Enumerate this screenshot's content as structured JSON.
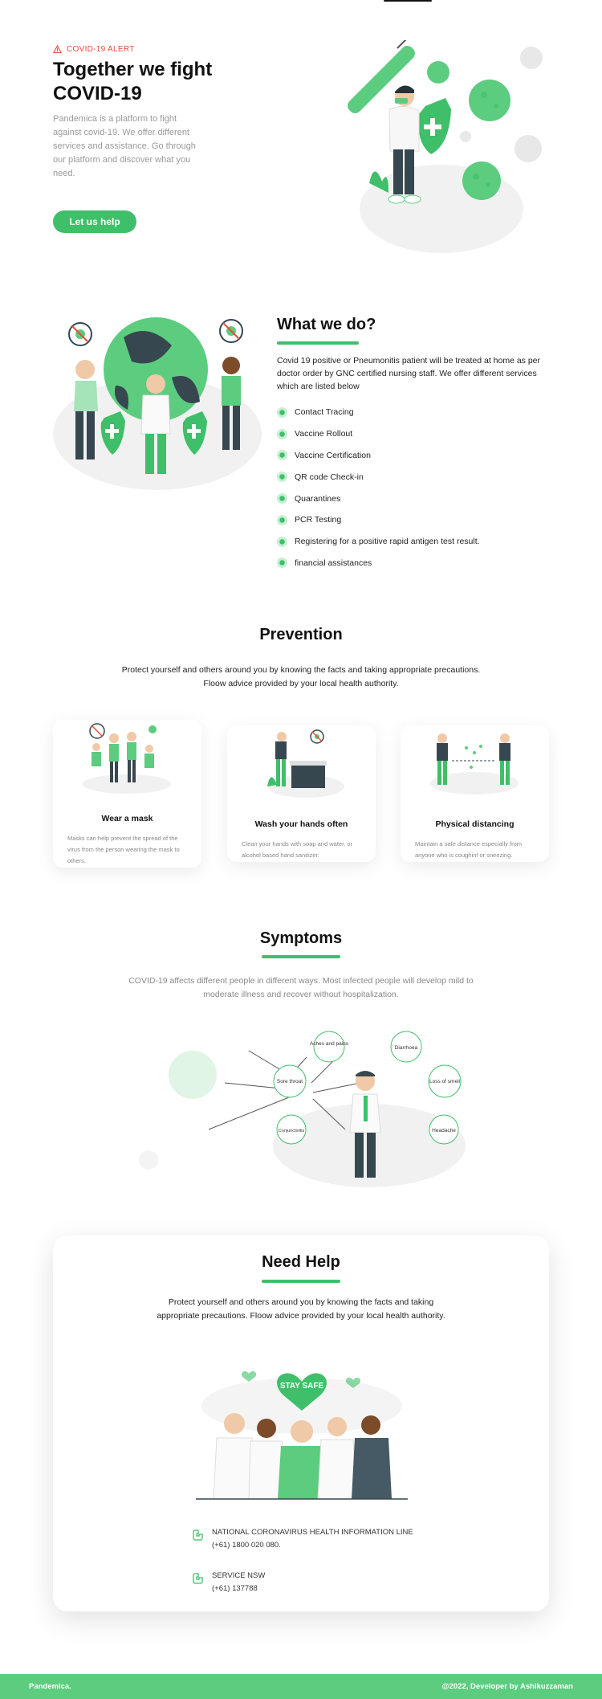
{
  "hero": {
    "alert": "COVID-19 ALERT",
    "title_line1": "Together we fight",
    "title_line2": "COVID-19",
    "description": "Pandemica is a platform to fight against covid-19. We offer different services and assistance. Go through our platform and discover what you need.",
    "cta": "Let us help"
  },
  "what_we_do": {
    "title": "What we do?",
    "description": "Covid 19 positive or Pneumonitis patient will be treated at home as per doctor order by GNC certified nursing staff. We offer different services which are listed below",
    "services": [
      "Contact Tracing",
      "Vaccine Rollout",
      "Vaccine Certification",
      "QR code Check-in",
      "Quarantines",
      "PCR Testing",
      "Registering for a positive rapid antigen test result.",
      "financial assistances"
    ]
  },
  "prevention": {
    "title": "Prevention",
    "description": "Protect yourself and others around you by knowing the facts and taking appropriate precautions. Floow advice provided by your local health authority.",
    "cards": [
      {
        "title": "Wear a mask",
        "text": "Masks can help prevent the spread of the virus from the person wearing the mask to others."
      },
      {
        "title": "Wash your hands often",
        "text": "Clean your hands with soap and water, or alcohol based hand sanitizer."
      },
      {
        "title": "Physical distancing",
        "text": "Maintain a safe distance especially from anyone who is coughinf or sneezing."
      }
    ]
  },
  "symptoms": {
    "title": "Symptoms",
    "description": "COVID-19 affects different people in different ways. Most infected people will develop mild to moderate illness and recover without hospitalization.",
    "labels": [
      "Aches and pains",
      "Diarrhoea",
      "Sore throat",
      "Loss of smell",
      "Conjunctivitis",
      "Headache"
    ]
  },
  "need_help": {
    "title": "Need Help",
    "description": "Protect yourself and others around you by knowing the facts and taking appropriate precautions. Floow advice provided by your local health authority.",
    "illustration_text": "STAY SAFE",
    "contacts": [
      {
        "label": "NATIONAL CORONAVIRUS HEALTH INFORMATION LINE",
        "phone": "(+61) 1800 020 080."
      },
      {
        "label": "SERVICE NSW",
        "phone": "(+61) 137788"
      }
    ]
  },
  "footer": {
    "brand": "Pandemica.",
    "credit": "@2022, Developer by Ashikuzzaman"
  },
  "colors": {
    "accent": "#3fbf69",
    "alert": "#e74c3c",
    "footer": "#5ccc7f"
  }
}
